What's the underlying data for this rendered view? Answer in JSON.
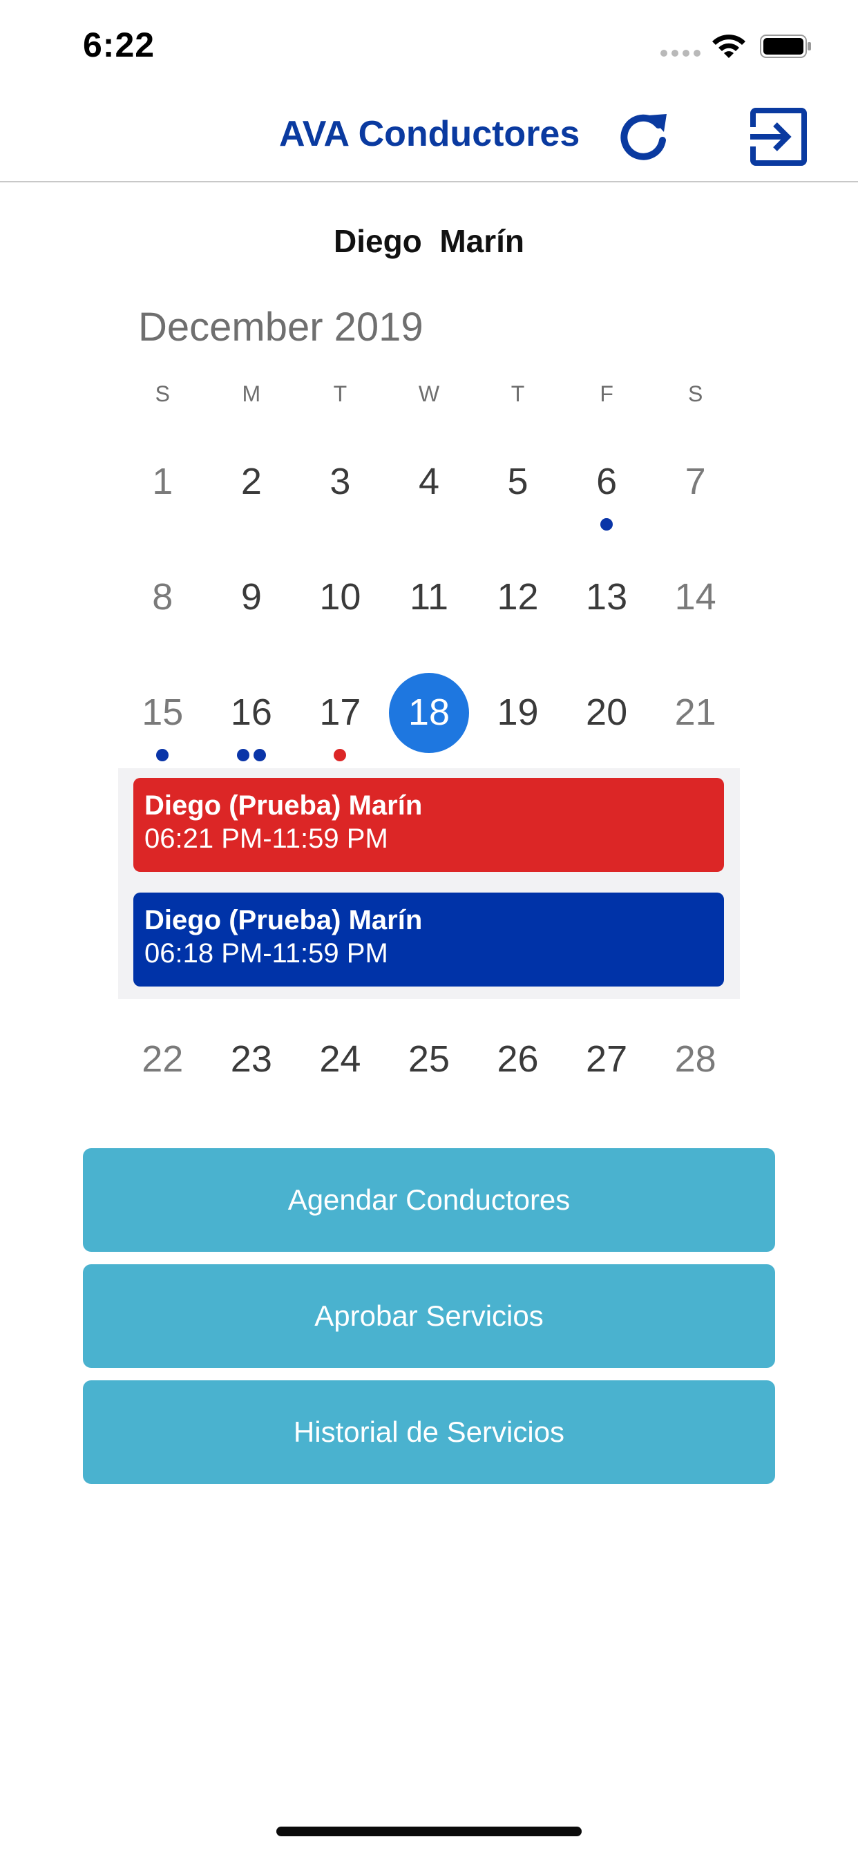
{
  "status_bar": {
    "time": "6:22",
    "icons": [
      "signal-icon",
      "wifi-icon",
      "battery-icon"
    ]
  },
  "header": {
    "title": "AVA Conductores",
    "refresh_icon": "refresh-icon",
    "logout_icon": "logout-icon"
  },
  "user": {
    "name": "Diego  Marín"
  },
  "calendar": {
    "month_title": "December 2019",
    "weekdays": [
      "S",
      "M",
      "T",
      "W",
      "T",
      "F",
      "S"
    ],
    "weeks": [
      [
        "1",
        "2",
        "3",
        "4",
        "5",
        "6",
        "7"
      ],
      [
        "8",
        "9",
        "10",
        "11",
        "12",
        "13",
        "14"
      ],
      [
        "15",
        "16",
        "17",
        "18",
        "19",
        "20",
        "21"
      ],
      [
        "22",
        "23",
        "24",
        "25",
        "26",
        "27",
        "28"
      ]
    ],
    "selected_day": "18",
    "colors": {
      "selected": "#1e77e0",
      "dot_blue": "#0a35a8",
      "dot_red": "#dc2626"
    }
  },
  "events": [
    {
      "name": "Diego (Prueba) Marín",
      "time": "06:21 PM-11:59 PM",
      "color": "#dc2626"
    },
    {
      "name": "Diego (Prueba) Marín",
      "time": "06:18 PM-11:59 PM",
      "color": "#0033a8"
    }
  ],
  "buttons": {
    "schedule_label": "Agendar Conductores",
    "approve_label": "Aprobar Servicios",
    "history_label": "Historial de Servicios",
    "color": "#4ab2cf"
  }
}
